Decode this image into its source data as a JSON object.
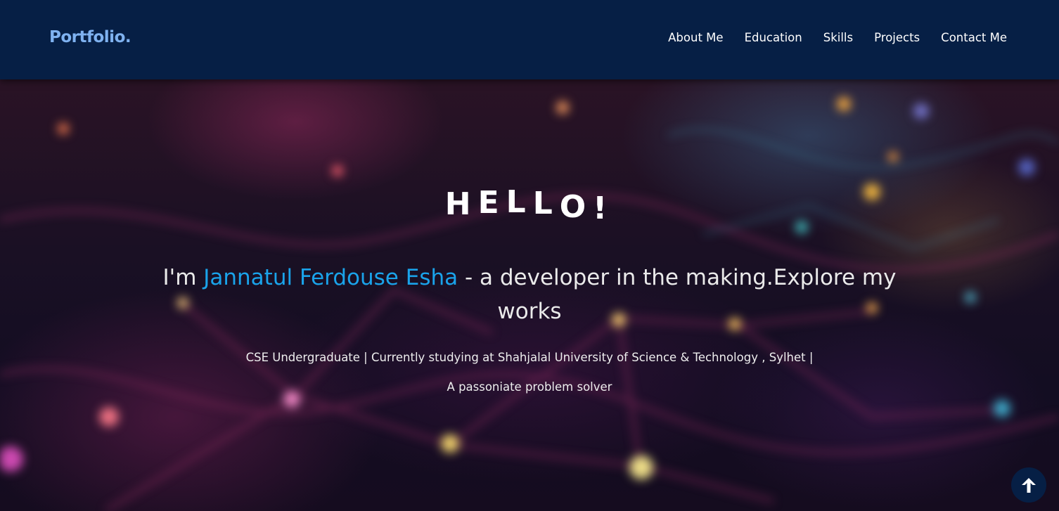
{
  "nav": {
    "logo": "Portfolio.",
    "links": [
      "About Me",
      "Education",
      "Skills",
      "Projects",
      "Contact Me"
    ]
  },
  "hero": {
    "greeting_letters": [
      "H",
      "E",
      "L",
      "L",
      "O",
      "!"
    ],
    "intro_prefix": "I'm ",
    "name": "Jannatul Ferdouse Esha",
    "intro_suffix": " - a developer in the making.Explore my works",
    "subtitle": "CSE Undergraduate | Currently studying at Shahjalal University of Science & Technology , Sylhet |",
    "tagline": "A passoniate problem solver"
  },
  "scroll_top": {
    "icon": "arrow-up-icon"
  },
  "colors": {
    "navbar_bg": "#061f45",
    "logo": "#7fb2f0",
    "accent_name": "#1aa3ea",
    "text": "#ffffff"
  }
}
